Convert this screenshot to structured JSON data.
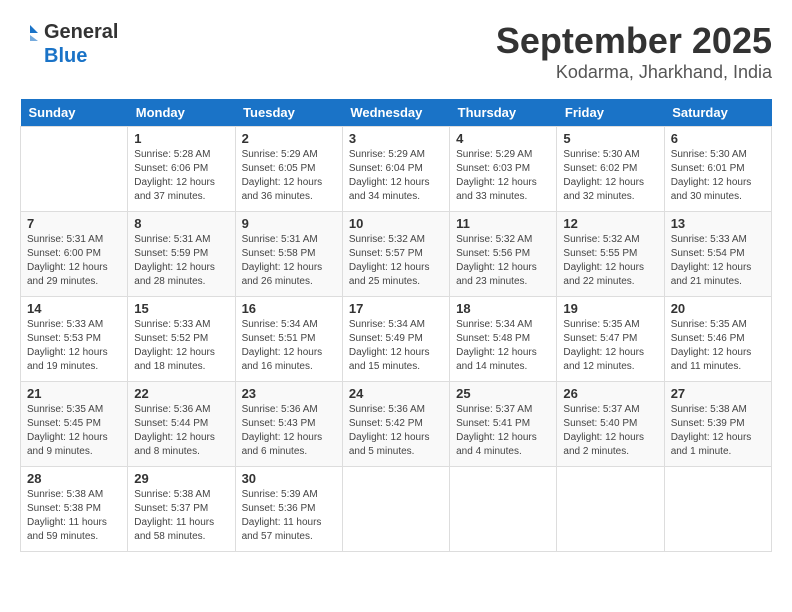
{
  "logo": {
    "line1": "General",
    "line2": "Blue"
  },
  "title": "September 2025",
  "location": "Kodarma, Jharkhand, India",
  "weekdays": [
    "Sunday",
    "Monday",
    "Tuesday",
    "Wednesday",
    "Thursday",
    "Friday",
    "Saturday"
  ],
  "weeks": [
    [
      {
        "day": "",
        "info": ""
      },
      {
        "day": "1",
        "info": "Sunrise: 5:28 AM\nSunset: 6:06 PM\nDaylight: 12 hours\nand 37 minutes."
      },
      {
        "day": "2",
        "info": "Sunrise: 5:29 AM\nSunset: 6:05 PM\nDaylight: 12 hours\nand 36 minutes."
      },
      {
        "day": "3",
        "info": "Sunrise: 5:29 AM\nSunset: 6:04 PM\nDaylight: 12 hours\nand 34 minutes."
      },
      {
        "day": "4",
        "info": "Sunrise: 5:29 AM\nSunset: 6:03 PM\nDaylight: 12 hours\nand 33 minutes."
      },
      {
        "day": "5",
        "info": "Sunrise: 5:30 AM\nSunset: 6:02 PM\nDaylight: 12 hours\nand 32 minutes."
      },
      {
        "day": "6",
        "info": "Sunrise: 5:30 AM\nSunset: 6:01 PM\nDaylight: 12 hours\nand 30 minutes."
      }
    ],
    [
      {
        "day": "7",
        "info": "Sunrise: 5:31 AM\nSunset: 6:00 PM\nDaylight: 12 hours\nand 29 minutes."
      },
      {
        "day": "8",
        "info": "Sunrise: 5:31 AM\nSunset: 5:59 PM\nDaylight: 12 hours\nand 28 minutes."
      },
      {
        "day": "9",
        "info": "Sunrise: 5:31 AM\nSunset: 5:58 PM\nDaylight: 12 hours\nand 26 minutes."
      },
      {
        "day": "10",
        "info": "Sunrise: 5:32 AM\nSunset: 5:57 PM\nDaylight: 12 hours\nand 25 minutes."
      },
      {
        "day": "11",
        "info": "Sunrise: 5:32 AM\nSunset: 5:56 PM\nDaylight: 12 hours\nand 23 minutes."
      },
      {
        "day": "12",
        "info": "Sunrise: 5:32 AM\nSunset: 5:55 PM\nDaylight: 12 hours\nand 22 minutes."
      },
      {
        "day": "13",
        "info": "Sunrise: 5:33 AM\nSunset: 5:54 PM\nDaylight: 12 hours\nand 21 minutes."
      }
    ],
    [
      {
        "day": "14",
        "info": "Sunrise: 5:33 AM\nSunset: 5:53 PM\nDaylight: 12 hours\nand 19 minutes."
      },
      {
        "day": "15",
        "info": "Sunrise: 5:33 AM\nSunset: 5:52 PM\nDaylight: 12 hours\nand 18 minutes."
      },
      {
        "day": "16",
        "info": "Sunrise: 5:34 AM\nSunset: 5:51 PM\nDaylight: 12 hours\nand 16 minutes."
      },
      {
        "day": "17",
        "info": "Sunrise: 5:34 AM\nSunset: 5:49 PM\nDaylight: 12 hours\nand 15 minutes."
      },
      {
        "day": "18",
        "info": "Sunrise: 5:34 AM\nSunset: 5:48 PM\nDaylight: 12 hours\nand 14 minutes."
      },
      {
        "day": "19",
        "info": "Sunrise: 5:35 AM\nSunset: 5:47 PM\nDaylight: 12 hours\nand 12 minutes."
      },
      {
        "day": "20",
        "info": "Sunrise: 5:35 AM\nSunset: 5:46 PM\nDaylight: 12 hours\nand 11 minutes."
      }
    ],
    [
      {
        "day": "21",
        "info": "Sunrise: 5:35 AM\nSunset: 5:45 PM\nDaylight: 12 hours\nand 9 minutes."
      },
      {
        "day": "22",
        "info": "Sunrise: 5:36 AM\nSunset: 5:44 PM\nDaylight: 12 hours\nand 8 minutes."
      },
      {
        "day": "23",
        "info": "Sunrise: 5:36 AM\nSunset: 5:43 PM\nDaylight: 12 hours\nand 6 minutes."
      },
      {
        "day": "24",
        "info": "Sunrise: 5:36 AM\nSunset: 5:42 PM\nDaylight: 12 hours\nand 5 minutes."
      },
      {
        "day": "25",
        "info": "Sunrise: 5:37 AM\nSunset: 5:41 PM\nDaylight: 12 hours\nand 4 minutes."
      },
      {
        "day": "26",
        "info": "Sunrise: 5:37 AM\nSunset: 5:40 PM\nDaylight: 12 hours\nand 2 minutes."
      },
      {
        "day": "27",
        "info": "Sunrise: 5:38 AM\nSunset: 5:39 PM\nDaylight: 12 hours\nand 1 minute."
      }
    ],
    [
      {
        "day": "28",
        "info": "Sunrise: 5:38 AM\nSunset: 5:38 PM\nDaylight: 11 hours\nand 59 minutes."
      },
      {
        "day": "29",
        "info": "Sunrise: 5:38 AM\nSunset: 5:37 PM\nDaylight: 11 hours\nand 58 minutes."
      },
      {
        "day": "30",
        "info": "Sunrise: 5:39 AM\nSunset: 5:36 PM\nDaylight: 11 hours\nand 57 minutes."
      },
      {
        "day": "",
        "info": ""
      },
      {
        "day": "",
        "info": ""
      },
      {
        "day": "",
        "info": ""
      },
      {
        "day": "",
        "info": ""
      }
    ]
  ]
}
